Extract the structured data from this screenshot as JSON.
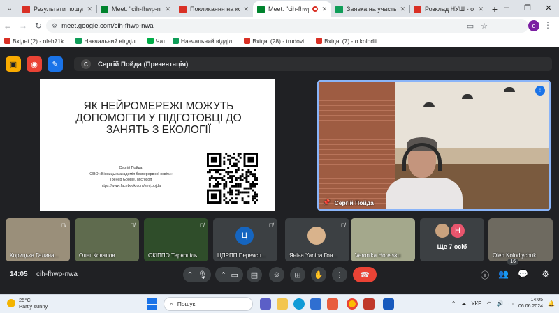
{
  "browser": {
    "tabs": [
      {
        "title": "Результати пошуку",
        "favicon": "gmail-icon",
        "color": "#d93025",
        "active": false
      },
      {
        "title": "Meet: \"cih-fhwp-nwa",
        "favicon": "meet-icon",
        "color": "#00832d",
        "active": false
      },
      {
        "title": "Покликання на конф",
        "favicon": "gmail-icon",
        "color": "#d93025",
        "active": false
      },
      {
        "title": "Meet: \"cih-fhwp-",
        "favicon": "meet-icon",
        "color": "#00832d",
        "active": true
      },
      {
        "title": "Заявка на участь в",
        "favicon": "forms-icon",
        "color": "#0f9d58",
        "active": false
      },
      {
        "title": "Розклад НУШ - o.kol",
        "favicon": "gmail-icon",
        "color": "#d93025",
        "active": false
      }
    ],
    "url": "meet.google.com/cih-fhwp-nwa",
    "profile_initial": "o",
    "bookmarks": [
      {
        "label": "Вхідні (2) - oleh71k...",
        "icon": "gmail-icon",
        "color": "#d93025"
      },
      {
        "label": "Навчальний відділ...",
        "icon": "sheets-icon",
        "color": "#0f9d58"
      },
      {
        "label": "Чат",
        "icon": "chat-icon",
        "color": "#00ac47"
      },
      {
        "label": "Навчальний відділ...",
        "icon": "sheets-icon",
        "color": "#0f9d58"
      },
      {
        "label": "Вхідні (28) - trudovi...",
        "icon": "gmail-icon",
        "color": "#d93025"
      },
      {
        "label": "Вхідні (7) - o.kolodii...",
        "icon": "gmail-icon",
        "color": "#d93025"
      }
    ]
  },
  "meet": {
    "presenter_chip": "Сергій Пойда (Презентація)",
    "presenter_initial": "С",
    "slide": {
      "title": "ЯК НЕЙРОМЕРЕЖІ МОЖУТЬ ДОПОМОГТИ У ПІДГОТОВЦІ ДО ЗАНЯТЬ З ЕКОЛОГІЇ",
      "lines": [
        "Сергій Пойда",
        "КЗВО «Вінницька академія безперервної освіти»",
        "Тренер Google, Microsoft",
        "https://www.facebook.com/serj.pojda"
      ]
    },
    "speaker_name": "Сергій Пойда",
    "participants": [
      {
        "name": "Корицька Галина...",
        "bg": "#9a8f7a",
        "muted": true
      },
      {
        "name": "Олег Ковалов",
        "bg": "#5f6b4e",
        "muted": true
      },
      {
        "name": "ОКІППО Тернопіль",
        "bg": "#2f4d2a",
        "muted": true
      },
      {
        "name": "ЦПРПП Переясл...",
        "bg": "#3c4043",
        "muted": true,
        "initial": "Ц",
        "circle": "#1565c0"
      },
      {
        "name": "Яніна Yanina Гон...",
        "bg": "#3c4043",
        "muted": true,
        "avatar": true
      },
      {
        "name": "Veronika Horetsku",
        "bg": "#a4a88c",
        "muted": false
      },
      {
        "name": "Ще 7 осіб",
        "bg": "#3c4043",
        "more": true
      },
      {
        "name": "Oleh Kolodiychuk",
        "bg": "#6e6a60",
        "muted": false
      }
    ],
    "time": "14:05",
    "code": "cih-fhwp-nwa",
    "people_count": "16"
  },
  "taskbar": {
    "temp": "25°C",
    "weather": "Partly sunny",
    "search_placeholder": "Пошук",
    "lang": "УКР",
    "time": "14:05",
    "date": "06.06.2024"
  }
}
